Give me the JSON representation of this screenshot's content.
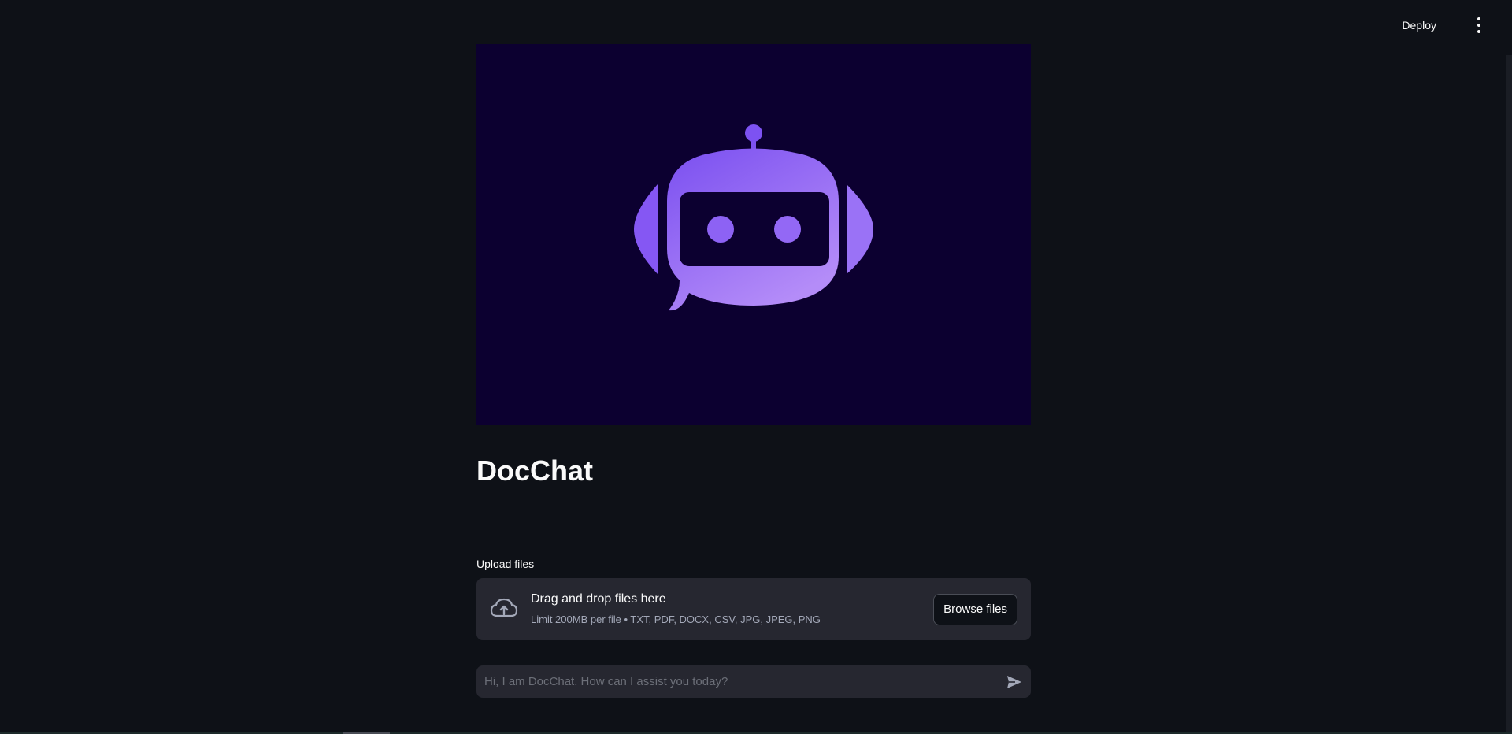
{
  "header": {
    "deploy_label": "Deploy",
    "menu_icon": "vertical-ellipsis-icon"
  },
  "hero": {
    "image": "robot-chat-logo",
    "background_color": "#0c0030",
    "accent_color": "#8b5cf6"
  },
  "page": {
    "title": "DocChat"
  },
  "uploader": {
    "label": "Upload files",
    "drop_title": "Drag and drop files here",
    "drop_subtitle": "Limit 200MB per file • TXT, PDF, DOCX, CSV, JPG, JPEG, PNG",
    "browse_label": "Browse files",
    "icon": "cloud-upload-icon"
  },
  "chat": {
    "placeholder": "Hi, I am DocChat. How can I assist you today?",
    "value": "",
    "send_icon": "send-icon"
  }
}
